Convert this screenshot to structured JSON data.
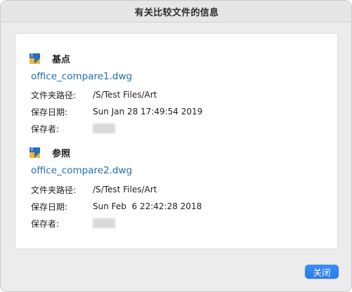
{
  "window": {
    "title": "有关比较文件的信息"
  },
  "base": {
    "label": "基点",
    "icon": "dwg-file-icon",
    "filename": "office_compare1.dwg",
    "folder_label": "文件夹路径:",
    "folder_value": "/S/Test Files/Art",
    "date_label": "保存日期:",
    "date_value": "Sun Jan 28 17:49:54 2019",
    "saver_label": "保存者:"
  },
  "reference": {
    "label": "参照",
    "icon": "dwg-file-icon",
    "filename": "office_compare2.dwg",
    "folder_label": "文件夹路径:",
    "folder_value": "/S/Test Files/Art",
    "date_label": "保存日期:",
    "date_value": "Sun Feb  6 22:42:28 2018",
    "saver_label": "保存者:"
  },
  "footer": {
    "close_label": "关闭"
  },
  "colors": {
    "accent": "#2a7ae7",
    "link": "#1f6fb0",
    "icon_blue": "#2a6fb8",
    "icon_yellow": "#f2b632"
  }
}
